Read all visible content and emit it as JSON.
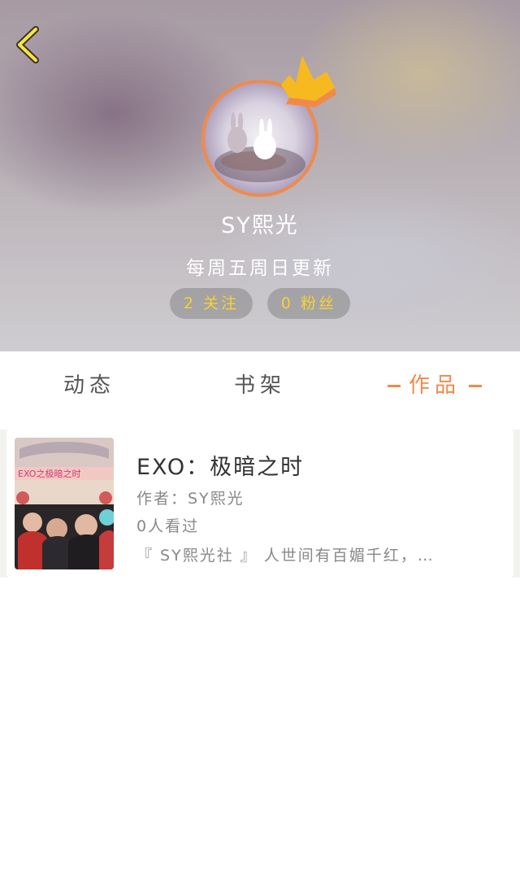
{
  "profile": {
    "name": "SY熙光",
    "subtitle": "每周五周日更新",
    "following": "2 关注",
    "fans": "0 粉丝"
  },
  "tabs": [
    {
      "label": "动态",
      "active": false
    },
    {
      "label": "书架",
      "active": false
    },
    {
      "label": "作品",
      "active": true
    }
  ],
  "works": [
    {
      "title": "EXO：极暗之时",
      "author": "作者：SY熙光",
      "views": "0人看过",
      "description": "『 SY熙光社 』 人世间有百媚千红，…",
      "cover_text": "EXO之极暗之时"
    }
  ],
  "colors": {
    "accent": "#f08a4b",
    "pill_text": "#f6d235"
  },
  "icons": {
    "back": "chevron-left-icon",
    "crown": "crown-icon"
  }
}
